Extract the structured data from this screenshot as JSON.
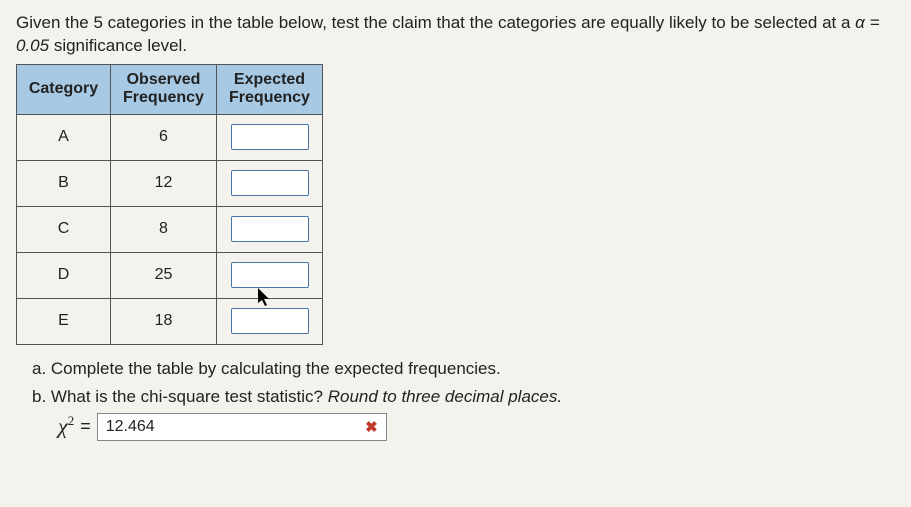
{
  "prompt": {
    "text_before": "Given the 5 categories in the table below, test the claim that the categories are equally likely to be selected at a ",
    "alpha_eq": "α = 0.05",
    "text_after": " significance level."
  },
  "table": {
    "headers": {
      "category": "Category",
      "observed_l1": "Observed",
      "observed_l2": "Frequency",
      "expected_l1": "Expected",
      "expected_l2": "Frequency"
    },
    "rows": [
      {
        "category": "A",
        "observed": "6",
        "expected": ""
      },
      {
        "category": "B",
        "observed": "12",
        "expected": ""
      },
      {
        "category": "C",
        "observed": "8",
        "expected": ""
      },
      {
        "category": "D",
        "observed": "25",
        "expected": ""
      },
      {
        "category": "E",
        "observed": "18",
        "expected": ""
      }
    ]
  },
  "questions": {
    "a": "a. Complete the table by calculating the expected frequencies.",
    "b_lead": "b. What is the chi-square test statistic? ",
    "b_ital": "Round to three decimal places."
  },
  "chi": {
    "symbol": "χ",
    "sup": "2",
    "eq": "=",
    "value": "12.464"
  },
  "icons": {
    "wrong": "✖"
  }
}
